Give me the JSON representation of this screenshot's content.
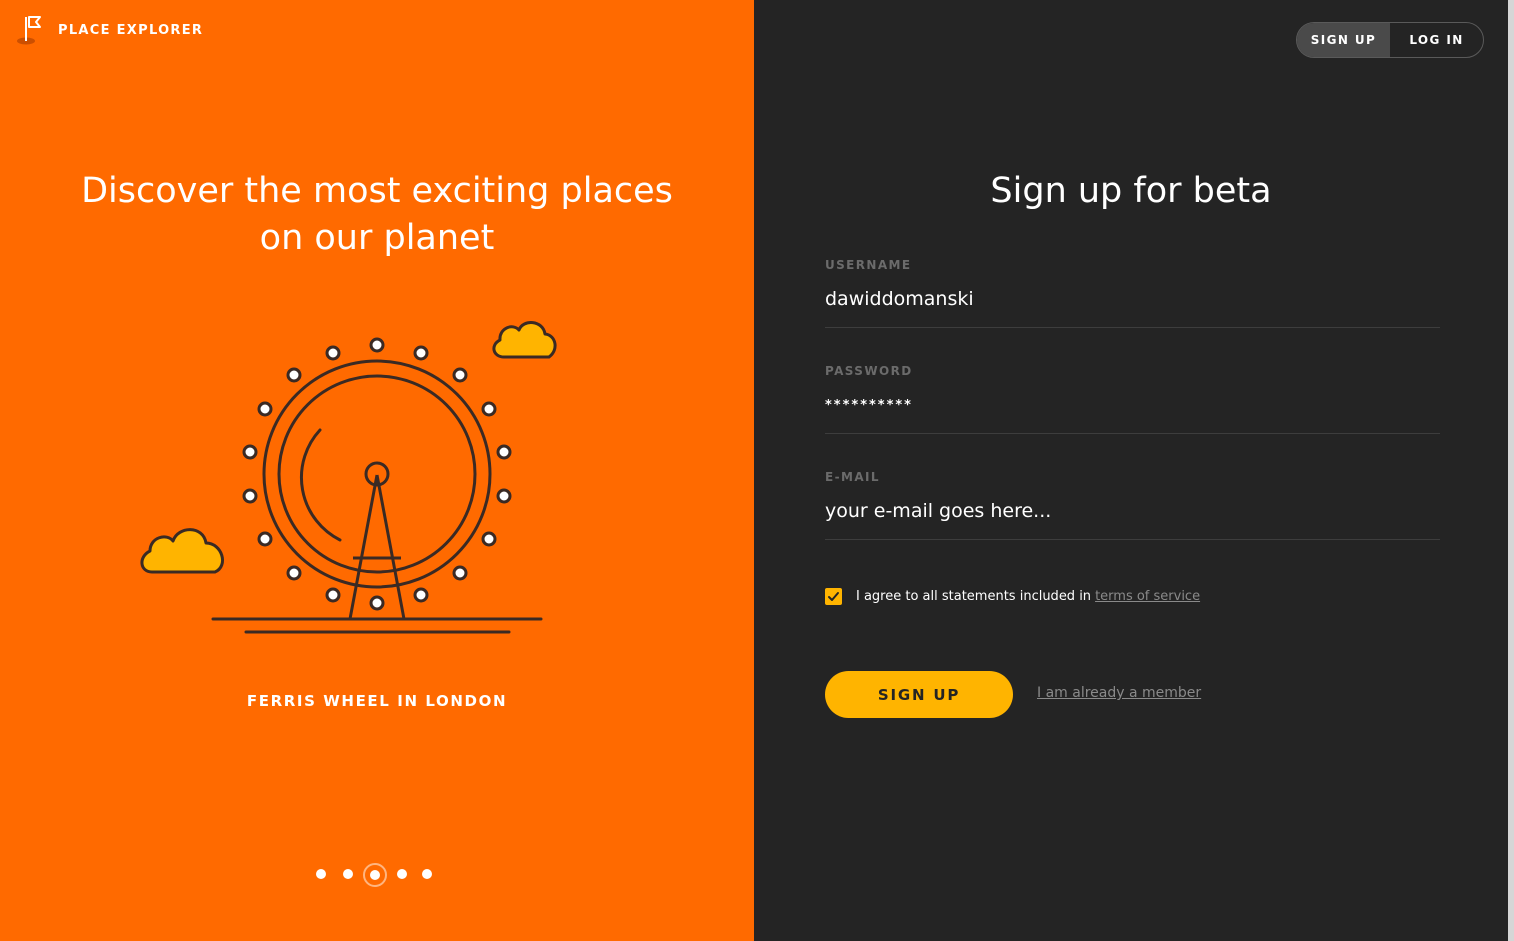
{
  "brand": {
    "name": "PLACE EXPLORER"
  },
  "hero": {
    "headline_line1": "Discover the most exciting places",
    "headline_line2": "on our planet",
    "caption": "FERRIS WHEEL IN LONDON",
    "slides_total": 5,
    "active_slide": 3
  },
  "auth_toggle": {
    "signup_label": "SIGN UP",
    "login_label": "LOG IN",
    "active": "signup"
  },
  "form": {
    "title": "Sign up for beta",
    "username": {
      "label": "USERNAME",
      "value": "dawiddomanski"
    },
    "password": {
      "label": "PASSWORD",
      "value": "**********"
    },
    "email": {
      "label": "E-MAIL",
      "placeholder": "your e-mail goes here..."
    },
    "terms": {
      "checked": true,
      "text": "I agree to all statements included in",
      "link": "terms of service"
    },
    "submit_label": "SIGN UP",
    "member_link": "I am already a member"
  },
  "colors": {
    "accent_orange": "#ff6a00",
    "accent_yellow": "#ffb400",
    "panel_dark": "#242424"
  }
}
